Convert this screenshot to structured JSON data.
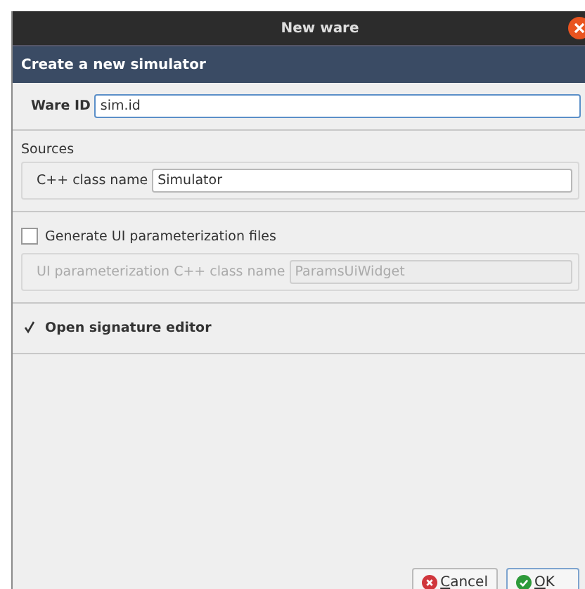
{
  "window": {
    "title": "New ware"
  },
  "header": {
    "title": "Create a new simulator"
  },
  "ware_id": {
    "label": "Ware ID",
    "value": "sim.id"
  },
  "sources": {
    "title": "Sources",
    "class_name": {
      "label": "C++ class name",
      "value": "Simulator"
    }
  },
  "generate_ui": {
    "label": "Generate UI parameterization files",
    "checked": false,
    "class_name": {
      "label": "UI parameterization C++ class name",
      "placeholder": "ParamsUiWidget",
      "disabled": true
    }
  },
  "open_editor": {
    "label": "Open signature editor",
    "checked": true
  },
  "buttons": [
    {
      "label": "Cancel",
      "kind": "cancel"
    },
    {
      "label": "OK",
      "kind": "ok"
    }
  ]
}
